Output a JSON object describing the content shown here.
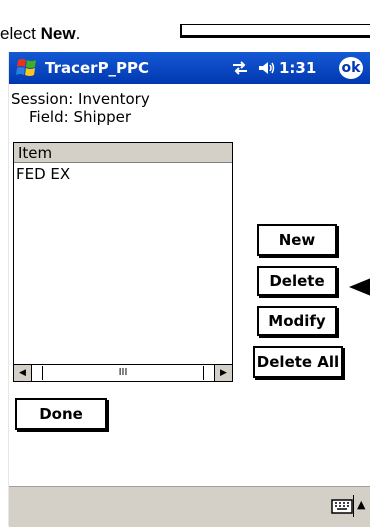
{
  "instruction": {
    "prefix": "elect ",
    "emphasis": "New",
    "suffix": "."
  },
  "titlebar": {
    "app_title": "TracerP_PPC",
    "time": "1:31",
    "ok_label": "ok"
  },
  "info": {
    "session_line": "Session: Inventory",
    "field_line": "Field: Shipper"
  },
  "list": {
    "header": "Item",
    "items": [
      "FED EX"
    ],
    "scroll_thumb_glyph": "III"
  },
  "buttons": {
    "new": "New",
    "delete": "Delete",
    "modify": "Modify",
    "delete_all": "Delete All",
    "done": "Done"
  },
  "colors": {
    "titlebar": "#0038b0",
    "bottombar": "#d4d0c8",
    "header": "#d4d0c8"
  },
  "icons": {
    "start": "windows-flag-icon",
    "connectivity": "connection-arrows-icon",
    "volume": "speaker-icon",
    "keyboard": "keyboard-icon",
    "input_menu": "triangle-up-icon"
  }
}
